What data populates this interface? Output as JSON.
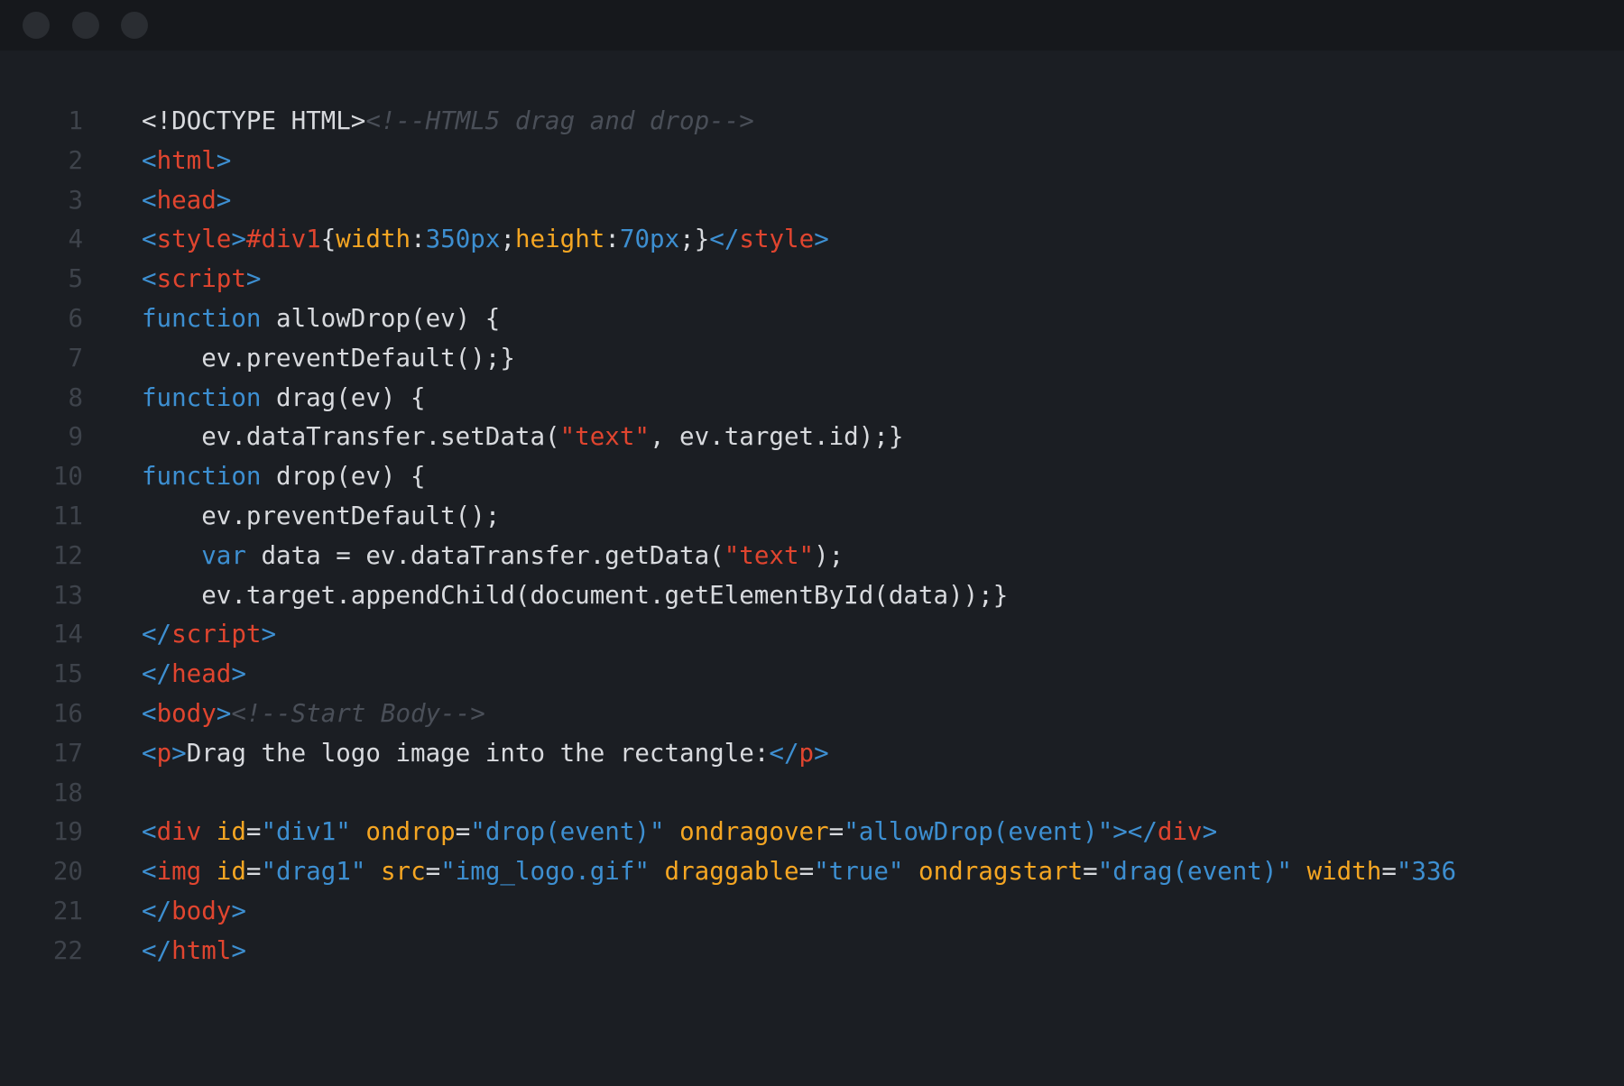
{
  "window": {
    "traffic_lights": [
      "close-dot",
      "minimize-dot",
      "maximize-dot"
    ]
  },
  "colors": {
    "background": "#1b1e23",
    "titlebar": "#16181c",
    "line_number": "#3e434b",
    "plain": "#d8dade",
    "bracket_keyword_value": "#3d8fd1",
    "tag_string": "#e0452f",
    "attribute_property": "#f5a623",
    "comment": "#4a4f58"
  },
  "lines": [
    {
      "n": "1",
      "tokens": [
        [
          "plain",
          "<!DOCTYPE HTML>"
        ],
        [
          "comment",
          "<!--HTML5 drag and drop-->"
        ]
      ]
    },
    {
      "n": "2",
      "tokens": [
        [
          "bracket",
          "<"
        ],
        [
          "tag",
          "html"
        ],
        [
          "bracket",
          ">"
        ]
      ]
    },
    {
      "n": "3",
      "tokens": [
        [
          "bracket",
          "<"
        ],
        [
          "tag",
          "head"
        ],
        [
          "bracket",
          ">"
        ]
      ]
    },
    {
      "n": "4",
      "tokens": [
        [
          "bracket",
          "<"
        ],
        [
          "tag",
          "style"
        ],
        [
          "bracket",
          ">"
        ],
        [
          "selector",
          "#div1"
        ],
        [
          "plain",
          "{"
        ],
        [
          "attr",
          "width"
        ],
        [
          "plain",
          ":"
        ],
        [
          "number",
          "350px"
        ],
        [
          "plain",
          ";"
        ],
        [
          "attr",
          "height"
        ],
        [
          "plain",
          ":"
        ],
        [
          "number",
          "70px"
        ],
        [
          "plain",
          ";}"
        ],
        [
          "bracket",
          "</"
        ],
        [
          "tag",
          "style"
        ],
        [
          "bracket",
          ">"
        ]
      ]
    },
    {
      "n": "5",
      "tokens": [
        [
          "bracket",
          "<"
        ],
        [
          "tag",
          "script"
        ],
        [
          "bracket",
          ">"
        ]
      ]
    },
    {
      "n": "6",
      "tokens": [
        [
          "keyword",
          "function"
        ],
        [
          "plain",
          " allowDrop(ev) {"
        ]
      ]
    },
    {
      "n": "7",
      "tokens": [
        [
          "plain",
          "    ev.preventDefault();}"
        ]
      ]
    },
    {
      "n": "8",
      "tokens": [
        [
          "keyword",
          "function"
        ],
        [
          "plain",
          " drag(ev) {"
        ]
      ]
    },
    {
      "n": "9",
      "tokens": [
        [
          "plain",
          "    ev.dataTransfer.setData("
        ],
        [
          "string",
          "\"text\""
        ],
        [
          "plain",
          ", ev.target.id);}"
        ]
      ]
    },
    {
      "n": "10",
      "tokens": [
        [
          "keyword",
          "function"
        ],
        [
          "plain",
          " drop(ev) {"
        ]
      ]
    },
    {
      "n": "11",
      "tokens": [
        [
          "plain",
          "    ev.preventDefault();"
        ]
      ]
    },
    {
      "n": "12",
      "tokens": [
        [
          "plain",
          "    "
        ],
        [
          "keyword",
          "var"
        ],
        [
          "plain",
          " data = ev.dataTransfer.getData("
        ],
        [
          "string",
          "\"text\""
        ],
        [
          "plain",
          ");"
        ]
      ]
    },
    {
      "n": "13",
      "tokens": [
        [
          "plain",
          "    ev.target.appendChild(document.getElementById(data));}"
        ]
      ]
    },
    {
      "n": "14",
      "tokens": [
        [
          "bracket",
          "</"
        ],
        [
          "tag",
          "script"
        ],
        [
          "bracket",
          ">"
        ]
      ]
    },
    {
      "n": "15",
      "tokens": [
        [
          "bracket",
          "</"
        ],
        [
          "tag",
          "head"
        ],
        [
          "bracket",
          ">"
        ]
      ]
    },
    {
      "n": "16",
      "tokens": [
        [
          "bracket",
          "<"
        ],
        [
          "tag",
          "body"
        ],
        [
          "bracket",
          ">"
        ],
        [
          "comment",
          "<!--Start Body-->"
        ]
      ]
    },
    {
      "n": "17",
      "tokens": [
        [
          "bracket",
          "<"
        ],
        [
          "tag",
          "p"
        ],
        [
          "bracket",
          ">"
        ],
        [
          "plain",
          "Drag the logo image into the rectangle:"
        ],
        [
          "bracket",
          "</"
        ],
        [
          "tag",
          "p"
        ],
        [
          "bracket",
          ">"
        ]
      ]
    },
    {
      "n": "18",
      "tokens": []
    },
    {
      "n": "19",
      "tokens": [
        [
          "bracket",
          "<"
        ],
        [
          "tag",
          "div"
        ],
        [
          "plain",
          " "
        ],
        [
          "attr",
          "id"
        ],
        [
          "plain",
          "="
        ],
        [
          "value",
          "\"div1\""
        ],
        [
          "plain",
          " "
        ],
        [
          "attr",
          "ondrop"
        ],
        [
          "plain",
          "="
        ],
        [
          "value",
          "\"drop(event)\""
        ],
        [
          "plain",
          " "
        ],
        [
          "attr",
          "ondragover"
        ],
        [
          "plain",
          "="
        ],
        [
          "value",
          "\"allowDrop(event)\""
        ],
        [
          "bracket",
          "></"
        ],
        [
          "tag",
          "div"
        ],
        [
          "bracket",
          ">"
        ]
      ]
    },
    {
      "n": "20",
      "tokens": [
        [
          "bracket",
          "<"
        ],
        [
          "tag",
          "img"
        ],
        [
          "plain",
          " "
        ],
        [
          "attr",
          "id"
        ],
        [
          "plain",
          "="
        ],
        [
          "value",
          "\"drag1\""
        ],
        [
          "plain",
          " "
        ],
        [
          "attr",
          "src"
        ],
        [
          "plain",
          "="
        ],
        [
          "value",
          "\"img_logo.gif\""
        ],
        [
          "plain",
          " "
        ],
        [
          "attr",
          "draggable"
        ],
        [
          "plain",
          "="
        ],
        [
          "value",
          "\"true\""
        ],
        [
          "plain",
          " "
        ],
        [
          "attr",
          "ondragstart"
        ],
        [
          "plain",
          "="
        ],
        [
          "value",
          "\"drag(event)\""
        ],
        [
          "plain",
          " "
        ],
        [
          "attr",
          "width"
        ],
        [
          "plain",
          "="
        ],
        [
          "value",
          "\"336"
        ]
      ]
    },
    {
      "n": "21",
      "tokens": [
        [
          "bracket",
          "</"
        ],
        [
          "tag",
          "body"
        ],
        [
          "bracket",
          ">"
        ]
      ]
    },
    {
      "n": "22",
      "tokens": [
        [
          "bracket",
          "</"
        ],
        [
          "tag",
          "html"
        ],
        [
          "bracket",
          ">"
        ]
      ]
    }
  ]
}
